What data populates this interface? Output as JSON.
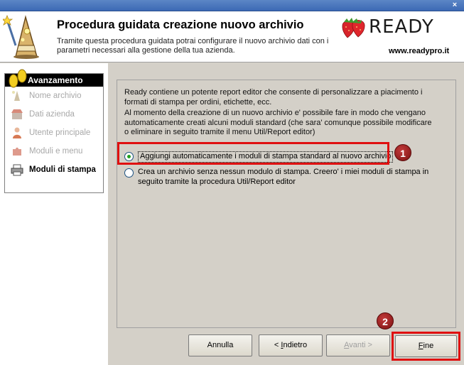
{
  "window": {
    "close_glyph": "×"
  },
  "header": {
    "title": "Procedura guidata creazione nuovo archivio",
    "description": "Tramite questa procedura guidata potrai configurare il nuovo archivio dati con i parametri necessari alla gestione della tua azienda.",
    "brand": "READY",
    "website": "www.readypro.it"
  },
  "sidebar": {
    "title": "Avanzamento",
    "steps": [
      {
        "label": "Nome archivio",
        "icon": "wand-icon",
        "state": "done"
      },
      {
        "label": "Dati azienda",
        "icon": "shop-icon",
        "state": "done"
      },
      {
        "label": "Utente principale",
        "icon": "user-icon",
        "state": "done"
      },
      {
        "label": "Moduli e menu",
        "icon": "puzzle-icon",
        "state": "done"
      },
      {
        "label": "Moduli di stampa",
        "icon": "printer-icon",
        "state": "active"
      }
    ]
  },
  "content": {
    "paragraph1": "Ready contiene un potente report editor che consente di personalizzare a piacimento i formati di stampa per ordini, etichette, ecc.",
    "paragraph2": "Al momento della creazione di un nuovo archivio e' possibile fare in modo che vengano automaticamente creati alcuni moduli standard (che sara' comunque possibile modificare o eliminare in seguito tramite il menu Util/Report editor)",
    "options": [
      {
        "label": "Aggiungi automaticamente i moduli di stampa standard al nuovo archivio",
        "checked": true
      },
      {
        "label": "Crea un archivio senza nessun modulo di stampa. Creero' i miei moduli di stampa in seguito tramite la procedura Util/Report editor",
        "checked": false
      }
    ]
  },
  "annotations": {
    "badge1": "1",
    "badge2": "2",
    "color": "#e01010"
  },
  "buttons": {
    "annulla": "Annulla",
    "indietro_prefix": "< ",
    "indietro_accel": "I",
    "indietro_rest": "ndietro",
    "avanti_accel": "A",
    "avanti_rest": "vanti >",
    "fine_accel": "F",
    "fine_rest": "ine"
  }
}
